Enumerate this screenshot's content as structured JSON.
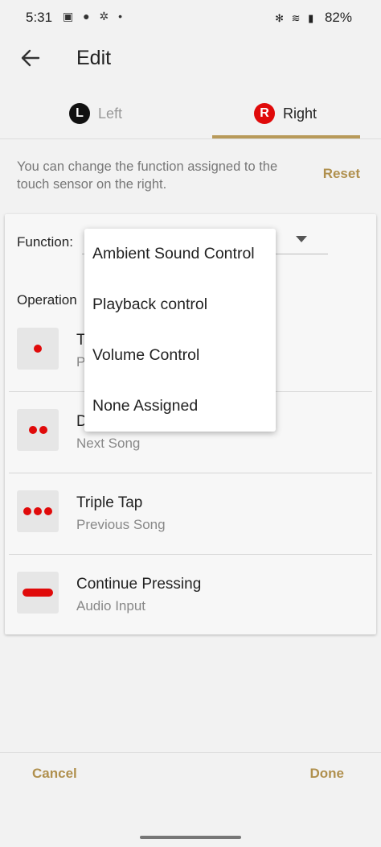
{
  "status_bar": {
    "time": "5:31",
    "left_icons": "▣ ● ✲ •",
    "right_icons": "✻ ≋ ▮",
    "battery": "82%"
  },
  "header": {
    "title": "Edit",
    "back_icon": "arrow-left-icon"
  },
  "tabs": [
    {
      "badge": "L",
      "label": "Left"
    },
    {
      "badge": "R",
      "label": "Right"
    }
  ],
  "description": "You can change the function assigned to the touch sensor on the right.",
  "reset_label": "Reset",
  "function_label": "Function:",
  "operation_label": "Operation",
  "operations": [
    {
      "name": "T",
      "action": "P"
    },
    {
      "name": "D",
      "action": "Next Song"
    },
    {
      "name": "Triple Tap",
      "action": "Previous Song"
    },
    {
      "name": "Continue Pressing",
      "action": "Audio Input"
    }
  ],
  "dropdown_options": [
    "Ambient Sound Control",
    "Playback control",
    "Volume Control",
    "None Assigned"
  ],
  "footer": {
    "cancel_label": "Cancel",
    "done_label": "Done"
  },
  "colors": {
    "accent": "#b0904e",
    "red": "#e00a0a"
  }
}
